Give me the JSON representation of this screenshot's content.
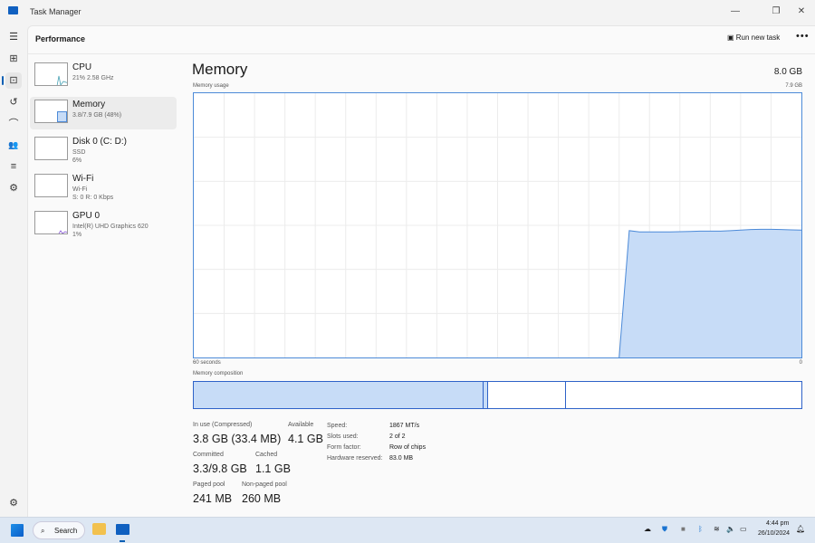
{
  "window": {
    "title": "Task Manager",
    "minimize": "—",
    "restore": "❐",
    "close": "✕"
  },
  "rail": {
    "menu": "☰",
    "processes": "⊞",
    "performance": "⊡",
    "history": "↺",
    "startup": "⌒",
    "users": "👥",
    "details": "≡",
    "services": "⚙",
    "settings": "⚙"
  },
  "header": {
    "title": "Performance",
    "run_new_task": "Run new task",
    "more": "•••"
  },
  "devices": [
    {
      "name": "CPU",
      "line1": "21%  2.58 GHz",
      "line2": ""
    },
    {
      "name": "Memory",
      "line1": "3.8/7.9 GB (48%)",
      "line2": ""
    },
    {
      "name": "Disk 0 (C: D:)",
      "line1": "SSD",
      "line2": "6%"
    },
    {
      "name": "Wi-Fi",
      "line1": "Wi-Fi",
      "line2": "S: 0  R: 0 Kbps"
    },
    {
      "name": "GPU 0",
      "line1": "Intel(R) UHD Graphics 620",
      "line2": "1%"
    }
  ],
  "memory": {
    "title": "Memory",
    "total": "8.0 GB",
    "usage_label": "Memory usage",
    "usage_max": "7.9 GB",
    "time_left": "60 seconds",
    "time_right": "0",
    "composition_label": "Memory composition"
  },
  "colors": {
    "accent": "#4c8ad8",
    "fill": "#c7dcf7",
    "comp_border": "#2e62c8"
  },
  "chart_data": {
    "type": "area",
    "xlabel": "60 seconds",
    "ylim": [
      0,
      7.9
    ],
    "xlim": [
      60,
      0
    ],
    "usage_percent": [
      0,
      0,
      0,
      0,
      0,
      0,
      0,
      0,
      0,
      0,
      0,
      0,
      0,
      0,
      0,
      0,
      0,
      0,
      0,
      0,
      0,
      0,
      0,
      0,
      0,
      0,
      0,
      0,
      0,
      0,
      0,
      0,
      0,
      0,
      0,
      0,
      0,
      0,
      0,
      0,
      0,
      0,
      0,
      48,
      47.5,
      47.5,
      47.5,
      47.5,
      47.6,
      47.7,
      47.8,
      47.8,
      47.8,
      48,
      48.2,
      48.4,
      48.5,
      48.5,
      48.4,
      48.3,
      48.2
    ]
  },
  "composition": {
    "in_use": 0.477,
    "modified": 0.008,
    "standby": 0.128,
    "free": 0.387
  },
  "stats": [
    {
      "label": "In use (Compressed)",
      "value": "3.8 GB (33.4 MB)"
    },
    {
      "label": "Available",
      "value": "4.1 GB"
    },
    {
      "label": "Committed",
      "value": "3.3/9.8 GB"
    },
    {
      "label": "Cached",
      "value": "1.1 GB"
    },
    {
      "label": "Paged pool",
      "value": "241 MB"
    },
    {
      "label": "Non-paged pool",
      "value": "260 MB"
    }
  ],
  "specs": [
    {
      "label": "Speed:",
      "value": "1867 MT/s"
    },
    {
      "label": "Slots used:",
      "value": "2 of 2"
    },
    {
      "label": "Form factor:",
      "value": "Row of chips"
    },
    {
      "label": "Hardware reserved:",
      "value": "83.0 MB"
    }
  ],
  "taskbar": {
    "search": "Search",
    "time": "4:44 pm",
    "date": "26/10/2024"
  }
}
